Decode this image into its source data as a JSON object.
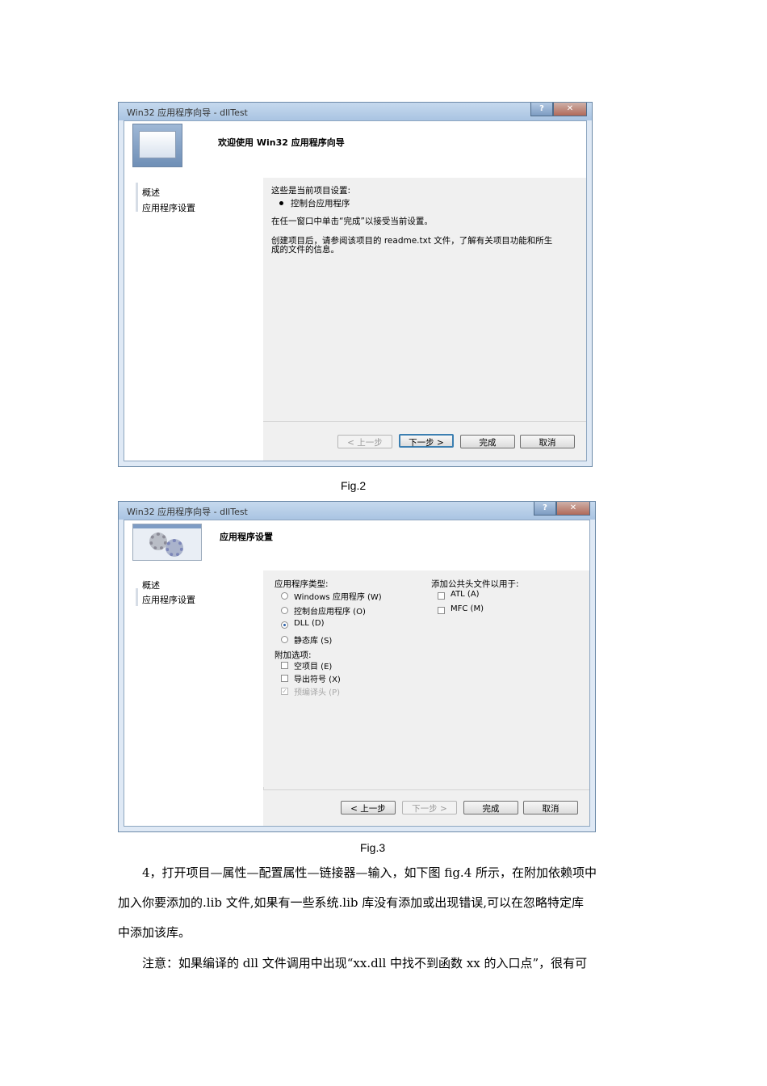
{
  "fig2": {
    "window_title": "Win32 应用程序向导 - dllTest",
    "help_glyph": "?",
    "close_glyph": "✕",
    "header_title": "欢迎使用 Win32 应用程序向导",
    "nav": [
      "概述",
      "应用程序设置"
    ],
    "lines": {
      "current_settings": "这些是当前项目设置:",
      "bullet": "控制台应用程序",
      "finish_hint": "在任一窗口中单击“完成”以接受当前设置。",
      "readme_1": "创建项目后，请参阅该项目的 readme.txt 文件，了解有关项目功能和所生",
      "readme_2": "成的文件的信息。"
    },
    "buttons": {
      "prev": "< 上一步",
      "next": "下一步 >",
      "finish": "完成",
      "cancel": "取消"
    },
    "caption": "Fig.2"
  },
  "fig3": {
    "window_title": "Win32 应用程序向导 - dllTest",
    "help_glyph": "?",
    "close_glyph": "✕",
    "header_title": "应用程序设置",
    "nav": [
      "概述",
      "应用程序设置"
    ],
    "app_type": {
      "label": "应用程序类型:",
      "options": [
        "Windows 应用程序 (W)",
        "控制台应用程序 (O)",
        "DLL (D)",
        "静态库 (S)"
      ],
      "selected": "DLL (D)"
    },
    "extra": {
      "label": "附加选项:",
      "options": [
        "空项目 (E)",
        "导出符号 (X)",
        "预编译头 (P)"
      ]
    },
    "common_headers": {
      "label": "添加公共头文件以用于:",
      "options": [
        "ATL (A)",
        "MFC (M)"
      ]
    },
    "buttons": {
      "prev": "< 上一步",
      "next": "下一步 >",
      "finish": "完成",
      "cancel": "取消"
    },
    "caption": "Fig.3"
  },
  "body_text": {
    "p1_line1": "4，打开项目—属性—配置属性—链接器—输入，如下图 fig.4 所示，在附加依赖项中",
    "p1_line2": "加入你要添加的.lib 文件,如果有一些系统.lib 库没有添加或出现错误,可以在忽略特定库",
    "p1_line3": "中添加该库。",
    "p2_line1": "注意：如果编译的 dll 文件调用中出现“xx.dll 中找不到函数 xx 的入口点”，很有可"
  }
}
